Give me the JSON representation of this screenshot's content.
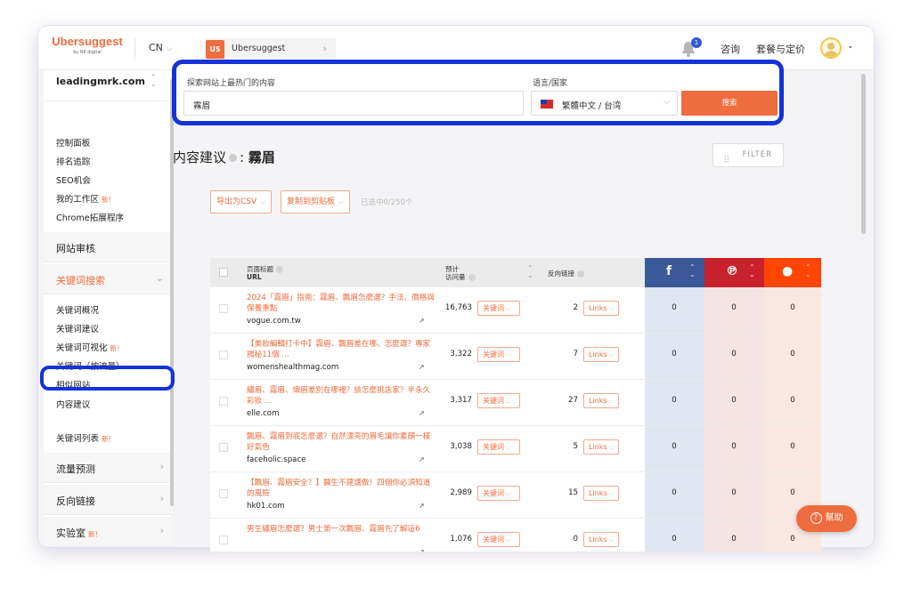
{
  "topbar": {
    "logo": "Ubersuggest",
    "logo_sub": "by NP digital",
    "country": "CN",
    "project_badge": "US",
    "project_name": "Ubersuggest",
    "notification_count": "1",
    "consult": "咨询",
    "pricing": "套餐与定价"
  },
  "sidebar": {
    "domain": "leadingmrk.com",
    "items_top": [
      {
        "label": "控制面板",
        "new": ""
      },
      {
        "label": "排名追踪",
        "new": ""
      },
      {
        "label": "SEO机会",
        "new": ""
      },
      {
        "label": "我的工作区",
        "new": "新！"
      },
      {
        "label": "Chrome拓展程序",
        "new": ""
      }
    ],
    "section_audit": "网站审核",
    "section_keyword": "关键词搜索",
    "items_keyword": [
      {
        "label": "关键词概况",
        "new": ""
      },
      {
        "label": "关键词建议",
        "new": ""
      },
      {
        "label": "关键词可视化",
        "new": "新！"
      },
      {
        "label": "关键词（按流量）",
        "new": ""
      },
      {
        "label": "相似网站",
        "new": ""
      },
      {
        "label": "内容建议",
        "new": ""
      }
    ],
    "keyword_lists": {
      "label": "关键词列表",
      "new": "新！"
    },
    "section_traffic": "流量预测",
    "section_backlinks": "反向链接",
    "section_labs": "实验室",
    "labs_new": "新！"
  },
  "search": {
    "label": "探索网站上最热门的内容",
    "value": "霧眉",
    "lang_label": "语言/国家",
    "lang_value": "繁體中文 / 台湾",
    "button": "搜索"
  },
  "page": {
    "title": "内容建议",
    "keyword": "霧眉",
    "filter": "FILTER",
    "export": "导出为CSV",
    "copy": "复制到剪贴板",
    "selected": "已选中0/250个"
  },
  "table": {
    "col_title": "页面标题",
    "col_url": "URL",
    "col_visits_1": "预计",
    "col_visits_2": "访问量",
    "col_backlinks": "反向链接",
    "keyword_btn": "关键词",
    "links_btn": "Links",
    "rows": [
      {
        "title": "2024「霧眉」指南：霧眉、飄眉怎麼選？手法、價格與保養重點",
        "url": "vogue.com.tw",
        "visits": "16,763",
        "backlinks": "2",
        "fb": "0",
        "pin": "0",
        "reddit": "0"
      },
      {
        "title": "【美妝編輯打卡中】霧眉、飄眉差在哪、怎麼選？專家揭秘11個 ...",
        "url": "womenshealthmag.com",
        "visits": "3,322",
        "backlinks": "7",
        "fb": "0",
        "pin": "0",
        "reddit": "0"
      },
      {
        "title": "繡眉、霧眉、織眉差別在哪裡？該怎麼挑店家？半永久彩妝 ...",
        "url": "elle.com",
        "visits": "3,317",
        "backlinks": "27",
        "fb": "0",
        "pin": "0",
        "reddit": "0"
      },
      {
        "title": "飄眉、霧眉到底怎麼選？自然漂亮的眉毛讓你素顏一樣好氣色",
        "url": "faceholic.space",
        "visits": "3,038",
        "backlinks": "5",
        "fb": "0",
        "pin": "0",
        "reddit": "0"
      },
      {
        "title": "【飄眉、霧眉安全？】醫生不建議做！四個你必須知道的風險",
        "url": "hk01.com",
        "visits": "2,989",
        "backlinks": "15",
        "fb": "0",
        "pin": "0",
        "reddit": "0"
      },
      {
        "title": "男生繡眉怎麼選？男士第一次飄眉、霧眉先了解這6",
        "url": "",
        "visits": "1,076",
        "backlinks": "0",
        "fb": "0",
        "pin": "0",
        "reddit": "0"
      }
    ]
  },
  "help": "幫助",
  "colors": {
    "brand": "#ee6c3d",
    "highlight": "#1433d8",
    "facebook": "#3b5998",
    "pinterest": "#c8232c",
    "reddit": "#ff4500"
  }
}
